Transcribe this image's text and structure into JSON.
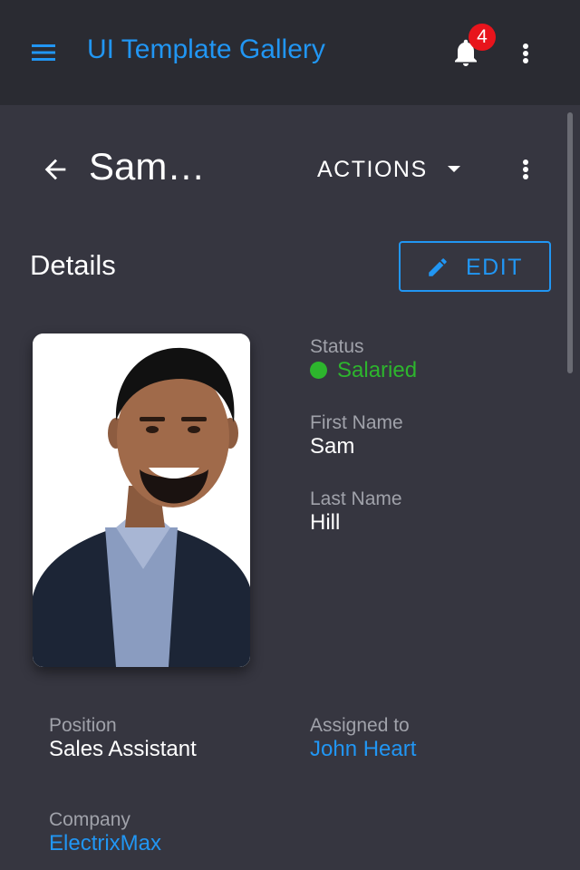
{
  "app": {
    "title": "UI Template Gallery",
    "notification_count": "4",
    "accent_color": "#2196f3"
  },
  "page": {
    "title": "Sam…",
    "actions_label": "ACTIONS",
    "section_title": "Details",
    "edit_label": "EDIT"
  },
  "details": {
    "status_label": "Status",
    "status_value": "Salaried",
    "status_color": "#2db52d",
    "first_name_label": "First Name",
    "first_name_value": "Sam",
    "last_name_label": "Last Name",
    "last_name_value": "Hill",
    "position_label": "Position",
    "position_value": "Sales Assistant",
    "assigned_label": "Assigned to",
    "assigned_value": "John Heart",
    "company_label": "Company",
    "company_value": "ElectrixMax"
  },
  "icons": {
    "menu": "menu-icon",
    "bell": "bell-icon",
    "more": "more-vertical-icon",
    "back": "arrow-back-icon",
    "caret": "caret-down-icon",
    "edit": "pencil-icon"
  }
}
